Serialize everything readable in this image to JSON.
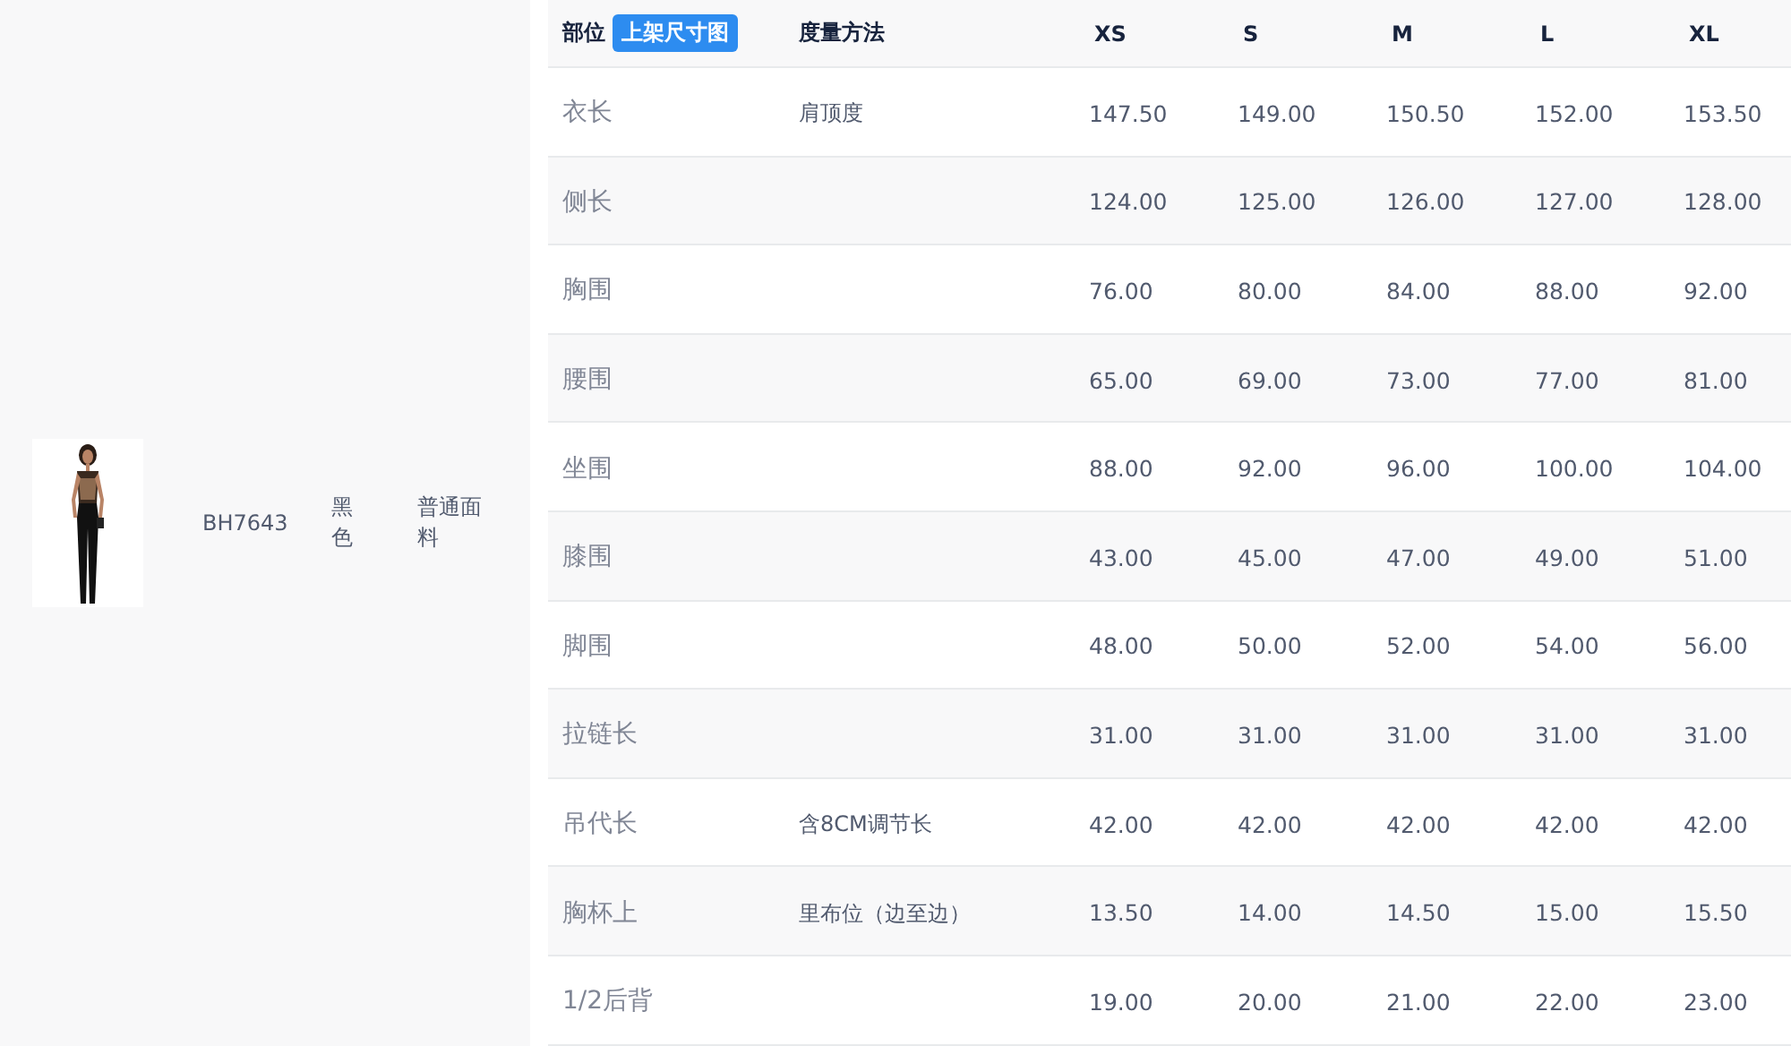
{
  "product": {
    "kind": "picture",
    "code": "BH7643",
    "color_name": "黑色",
    "fabric": "普通面料"
  },
  "table": {
    "columns": [
      {
        "label": "部位",
        "tag": "上架尺寸图"
      },
      {
        "label": "度量方法"
      },
      {
        "label": "XS"
      },
      {
        "label": "S"
      },
      {
        "label": "M"
      },
      {
        "label": "L"
      },
      {
        "label": "XL"
      }
    ],
    "rows": [
      {
        "part": "衣长",
        "method": "肩顶度",
        "values": [
          "147.50",
          "149.00",
          "150.50",
          "152.00",
          "153.50"
        ]
      },
      {
        "part": "侧长",
        "values": [
          "124.00",
          "125.00",
          "126.00",
          "127.00",
          "128.00"
        ]
      },
      {
        "part": "胸围",
        "values": [
          "76.00",
          "80.00",
          "84.00",
          "88.00",
          "92.00"
        ]
      },
      {
        "part": "腰围",
        "values": [
          "65.00",
          "69.00",
          "73.00",
          "77.00",
          "81.00"
        ]
      },
      {
        "part": "坐围",
        "values": [
          "88.00",
          "92.00",
          "96.00",
          "100.00",
          "104.00"
        ]
      },
      {
        "part": "膝围",
        "values": [
          "43.00",
          "45.00",
          "47.00",
          "49.00",
          "51.00"
        ]
      },
      {
        "part": "脚围",
        "values": [
          "48.00",
          "50.00",
          "52.00",
          "54.00",
          "56.00"
        ]
      },
      {
        "part": "拉链长",
        "values": [
          "31.00",
          "31.00",
          "31.00",
          "31.00",
          "31.00"
        ]
      },
      {
        "part": "吊代长",
        "method": "含8CM调节长",
        "values": [
          "42.00",
          "42.00",
          "42.00",
          "42.00",
          "42.00"
        ]
      },
      {
        "part": "胸杯上",
        "method": "里布位（边至边）",
        "values": [
          "13.50",
          "14.00",
          "14.50",
          "15.00",
          "15.50"
        ]
      },
      {
        "part": "1/2后背",
        "values": [
          "19.00",
          "20.00",
          "21.00",
          "22.00",
          "23.00"
        ]
      }
    ]
  }
}
